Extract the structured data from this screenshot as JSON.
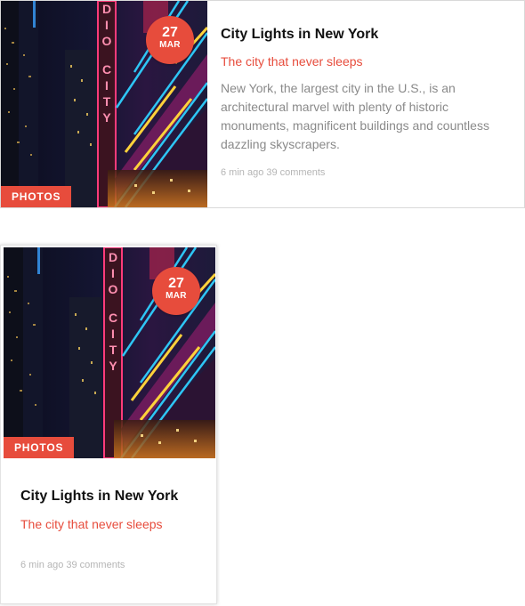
{
  "cards": [
    {
      "layout": "horizontal",
      "date_day": "27",
      "date_month": "MAR",
      "category": "PHOTOS",
      "title": "City Lights in New York",
      "subtitle": "The city that never sleeps",
      "excerpt": "New York, the largest city in the U.S., is an architectural marvel with plenty of historic monuments, magnificent buildings and countless dazzling skyscrapers.",
      "meta": "6 min ago 39 comments"
    },
    {
      "layout": "vertical",
      "date_day": "27",
      "date_month": "MAR",
      "category": "PHOTOS",
      "title": "City Lights in New York",
      "subtitle": "The city that never sleeps",
      "meta": "6 min ago 39 comments"
    }
  ],
  "colors": {
    "accent": "#e74c3c",
    "title": "#111111",
    "excerpt": "#8a8a8a",
    "meta": "#b5b5b5",
    "card_border": "#d9d9d9"
  },
  "photo": {
    "sign_text": "DIO CITY"
  }
}
